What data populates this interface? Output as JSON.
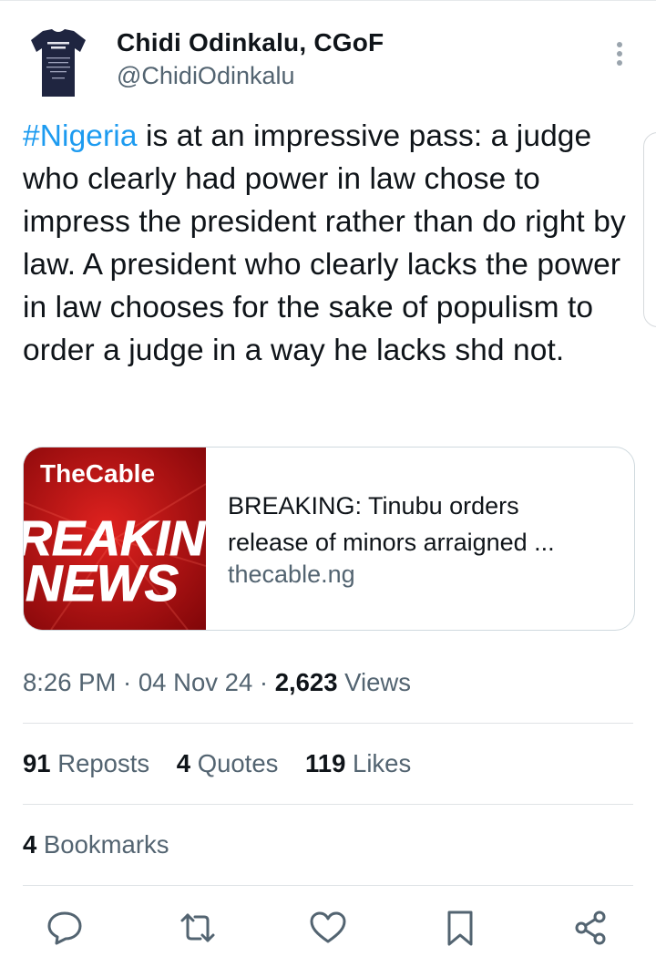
{
  "author": {
    "name": "Chidi Odinkalu, CGoF",
    "handle": "@ChidiOdinkalu",
    "avatar_icon": "avatar-tshirt-icon"
  },
  "tweet": {
    "hashtag": "#Nigeria",
    "body": " is at an impressive pass: a judge who clearly had power in law chose to impress the president rather than do right by law. A president who clearly lacks the power in law chooses for the sake of populism to order a judge in a way he lacks shd not."
  },
  "link_card": {
    "thumb_brand": "TheCable",
    "thumb_line1": "REAKIN",
    "thumb_line2": "NEWS",
    "title_line1": "BREAKING: Tinubu orders",
    "title_line2": "release of minors arraigned ...",
    "domain": "thecable.ng"
  },
  "meta": {
    "time": "8:26 PM",
    "sep1": " · ",
    "date": "04 Nov 24",
    "sep2": " · ",
    "views_count": "2,623",
    "views_label": " Views"
  },
  "stats": {
    "reposts_count": "91",
    "reposts_label": " Reposts",
    "quotes_count": "4",
    "quotes_label": " Quotes",
    "likes_count": "119",
    "likes_label": " Likes",
    "bookmarks_count": "4",
    "bookmarks_label": " Bookmarks"
  },
  "actions": [
    "reply-icon",
    "repost-icon",
    "like-icon",
    "bookmark-icon",
    "share-icon"
  ],
  "colors": {
    "accent": "#1d9bf0",
    "text": "#0f1419",
    "muted": "#536471",
    "icon": "#536471",
    "thumb_red": "#b30e10"
  }
}
